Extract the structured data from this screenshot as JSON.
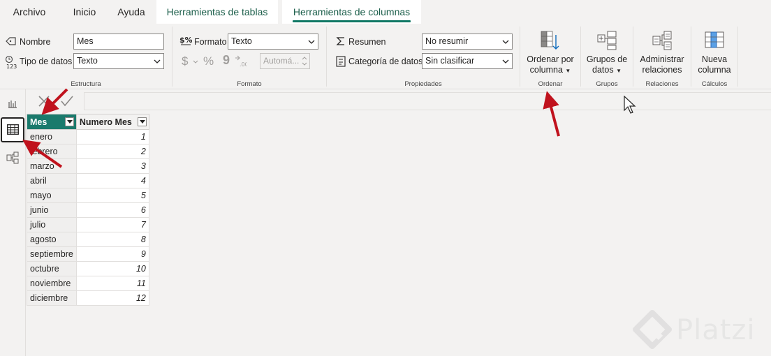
{
  "tabs": [
    {
      "label": "Archivo"
    },
    {
      "label": "Inicio"
    },
    {
      "label": "Ayuda"
    },
    {
      "label": "Herramientas de tablas"
    },
    {
      "label": "Herramientas de columnas"
    }
  ],
  "ribbon": {
    "estructura": {
      "nombre_label": "Nombre",
      "nombre_value": "Mes",
      "tipo_label": "Tipo de datos",
      "tipo_value": "Texto",
      "group_label": "Estructura"
    },
    "formato": {
      "formato_label": "Formato",
      "formato_value": "Texto",
      "currency_symbol": "$",
      "percent_symbol": "%",
      "comma_symbol": "9",
      "auto_value": "Automá...",
      "group_label": "Formato"
    },
    "propiedades": {
      "resumen_label": "Resumen",
      "resumen_value": "No resumir",
      "categoria_label": "Categoría de datos",
      "categoria_value": "Sin clasificar",
      "group_label": "Propiedades"
    },
    "ordenar": {
      "line1": "Ordenar por",
      "line2": "columna",
      "group_label": "Ordenar"
    },
    "grupos": {
      "line1": "Grupos de",
      "line2": "datos",
      "group_label": "Grupos"
    },
    "relaciones": {
      "line1": "Administrar",
      "line2": "relaciones",
      "group_label": "Relaciones"
    },
    "calculos": {
      "line1": "Nueva",
      "line2": "columna",
      "group_label": "Cálculos"
    }
  },
  "table": {
    "headers": [
      "Mes",
      "Numero Mes"
    ],
    "rows": [
      {
        "mes": "enero",
        "num": "1"
      },
      {
        "mes": "febrero",
        "num": "2"
      },
      {
        "mes": "marzo",
        "num": "3"
      },
      {
        "mes": "abril",
        "num": "4"
      },
      {
        "mes": "mayo",
        "num": "5"
      },
      {
        "mes": "junio",
        "num": "6"
      },
      {
        "mes": "julio",
        "num": "7"
      },
      {
        "mes": "agosto",
        "num": "8"
      },
      {
        "mes": "septiembre",
        "num": "9"
      },
      {
        "mes": "octubre",
        "num": "10"
      },
      {
        "mes": "noviembre",
        "num": "11"
      },
      {
        "mes": "diciembre",
        "num": "12"
      }
    ]
  },
  "watermark": {
    "text": "Platzi"
  },
  "colors": {
    "accent": "#117865",
    "header_fill": "#1a7a6c",
    "annotation_arrow": "#c0121d"
  }
}
